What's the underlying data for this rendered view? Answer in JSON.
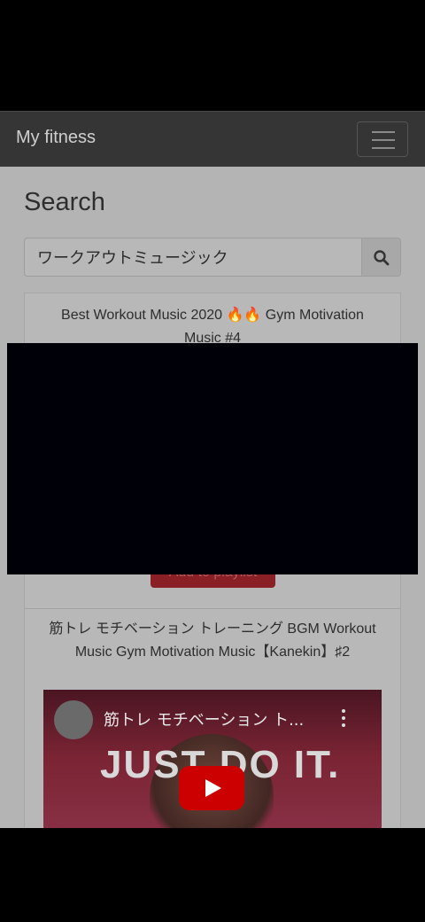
{
  "navbar": {
    "brand": "My fitness",
    "menu_icon": "hamburger-menu-icon"
  },
  "page": {
    "title": "Search"
  },
  "search": {
    "value": "ワークアウトミュージック",
    "placeholder": "",
    "button_icon": "search-icon"
  },
  "results": [
    {
      "title": "Best Workout Music 2020 🔥🔥 Gym Motivation Music #4",
      "add_label": "Add to playlist"
    },
    {
      "title": "筋トレ モチベーション トレーニング BGM Workout Music Gym Motivation Music【Kanekin】♯2",
      "video": {
        "overlay_title": "筋トレ モチベーション ト...",
        "thumbnail_text": "JUST DO IT.",
        "play_icon": "play-icon",
        "more_icon": "more-vert-icon"
      }
    }
  ],
  "colors": {
    "navbar_bg": "#353535",
    "button_red": "#8a1f25",
    "youtube_red": "#cc0000"
  }
}
